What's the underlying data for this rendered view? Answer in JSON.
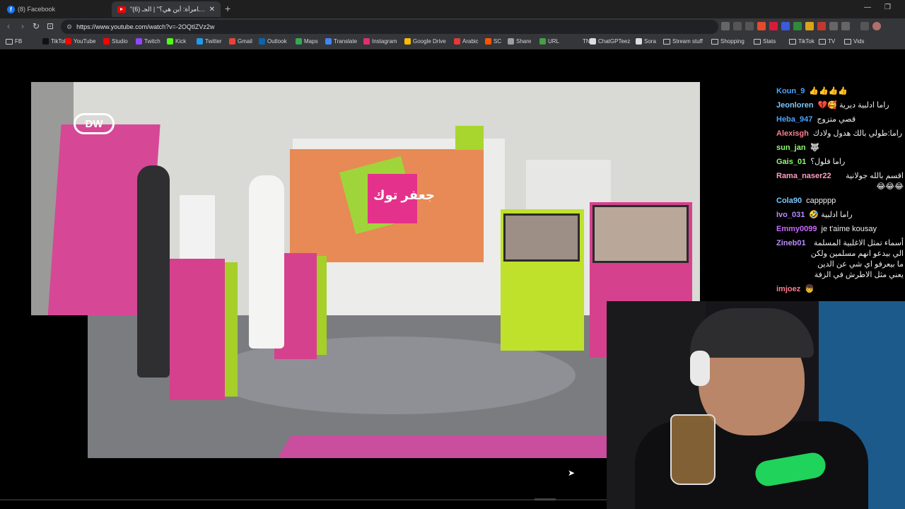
{
  "tabs": [
    {
      "title": "(8) Facebook",
      "icon": "facebook-icon"
    },
    {
      "title": "\"حقوقي كامرأة: أين هي؟\" | الجـ (6)",
      "icon": "youtube-icon"
    }
  ],
  "address": {
    "url": "https://www.youtube.com/watch?v=-2OQtIZVz2w"
  },
  "bookmarks": [
    {
      "label": "FB",
      "icon": "folder-icon",
      "color": "#cccccc"
    },
    {
      "label": "TikTok",
      "icon": "tiktok-icon",
      "color": "#111111"
    },
    {
      "label": "YouTube",
      "icon": "youtube-icon",
      "color": "#ff0000"
    },
    {
      "label": "Studio",
      "icon": "youtube-studio-icon",
      "color": "#ff0000"
    },
    {
      "label": "Twitch",
      "icon": "twitch-icon",
      "color": "#9146ff"
    },
    {
      "label": "Kick",
      "icon": "kick-icon",
      "color": "#53fc18"
    },
    {
      "label": "Twitter",
      "icon": "twitter-icon",
      "color": "#1d9bf0"
    },
    {
      "label": "Gmail",
      "icon": "gmail-icon",
      "color": "#ea4335"
    },
    {
      "label": "Outlook",
      "icon": "outlook-icon",
      "color": "#0a64ad"
    },
    {
      "label": "Maps",
      "icon": "maps-icon",
      "color": "#34a853"
    },
    {
      "label": "Translate",
      "icon": "translate-icon",
      "color": "#4285f4"
    },
    {
      "label": "Instagram",
      "icon": "instagram-icon",
      "color": "#e1306c"
    },
    {
      "label": "Google Drive",
      "icon": "drive-icon",
      "color": "#fbbc04"
    },
    {
      "label": "Arabic",
      "icon": "arabic-icon",
      "color": "#e53935"
    },
    {
      "label": "SC",
      "icon": "sc-icon",
      "color": "#ff5500"
    },
    {
      "label": "Share",
      "icon": "share-icon",
      "color": "#9e9e9e"
    },
    {
      "label": "URL",
      "icon": "url-icon",
      "color": "#43a047"
    },
    {
      "label": "TN",
      "icon": "tn-icon",
      "color": "#35363a"
    },
    {
      "label": "ChatGPTeez",
      "icon": "chatgpt-icon",
      "color": "#dddddd"
    },
    {
      "label": "Sora",
      "icon": "sora-icon",
      "color": "#dddddd"
    },
    {
      "label": "Stream stuff",
      "icon": "folder-icon",
      "color": "#cccccc"
    },
    {
      "label": "Shopping",
      "icon": "folder-icon",
      "color": "#cccccc"
    },
    {
      "label": "Stats",
      "icon": "folder-icon",
      "color": "#cccccc"
    },
    {
      "label": "TikTok",
      "icon": "folder-icon",
      "color": "#cccccc"
    },
    {
      "label": "TV",
      "icon": "folder-icon",
      "color": "#cccccc"
    },
    {
      "label": "Vids",
      "icon": "folder-icon",
      "color": "#cccccc"
    }
  ],
  "video": {
    "logo": "DW",
    "show_logo": "جعفر توك"
  },
  "chat": [
    {
      "user": "Koun_9",
      "msg": "👍👍👍👍",
      "color": "#4da3ff"
    },
    {
      "user": "Jeonloren",
      "msg": "راما ادلبية ديرية 🥰💔",
      "color": "#7ec8ff"
    },
    {
      "user": "Heba_947",
      "msg": "قصي متزوج",
      "color": "#4da3ff"
    },
    {
      "user": "Alexisgh",
      "msg": "راما:طولي بالك هدول ولادك",
      "color": "#ff7f8f"
    },
    {
      "user": "sun_jan",
      "msg": "🐺",
      "color": "#8eff6b"
    },
    {
      "user": "Gais_01",
      "msg": "راما فلول؟",
      "color": "#8eff6b"
    },
    {
      "user": "Rama_naser22",
      "msg": "اقسم بالله جولانية 😂😂😂",
      "color": "#ff9ec4"
    },
    {
      "user": "Cola90",
      "msg": "cappppp",
      "color": "#7ec8ff"
    },
    {
      "user": "Ivo_031",
      "msg": "راما ادلبية 🤣",
      "color": "#b98cff"
    },
    {
      "user": "Emmy0099",
      "msg": "je t'aime kousay",
      "color": "#c86bff"
    },
    {
      "user": "Zineb01",
      "msg": "أسماء تمثل الاغلبية المسلمة الي بيدعو انهم مسلمين ولكن ما بيعرفو اي شي عن الدين يعني مثل الاطرش في الزفة",
      "color": "#b98cff"
    },
    {
      "user": "imjoez",
      "msg": "👦",
      "color": "#ff7f8f"
    }
  ]
}
